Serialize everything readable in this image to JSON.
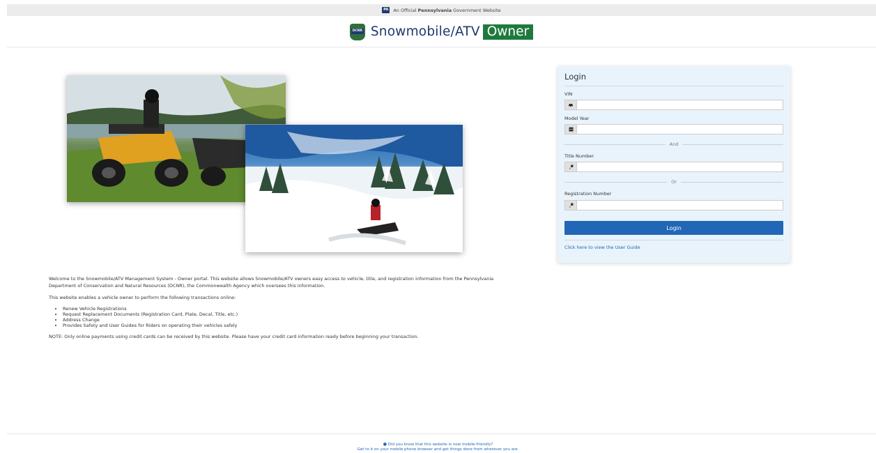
{
  "gov_bar": {
    "badge": "PA",
    "prefix": "An Official",
    "state": "Pennsylvania",
    "suffix": "Government Website"
  },
  "header": {
    "logo_text": "DCNR",
    "brand": "Snowmobile/ATV",
    "tag": "Owner"
  },
  "images": {
    "atv": "atv-photo",
    "snowmobile": "snowmobile-photo"
  },
  "intro": {
    "welcome": "Welcome to the Snowmobile/ATV Management System - Owner portal. This website allows Snowmobile/ATV owners easy access to vehicle, title, and registration information from the Pennsylvania Department of Conservation and Natural Resources (DCNR), the Commonwealth Agency which oversees this information.",
    "enables": "This website enables a vehicle owner to perform the following transactions online:",
    "items": [
      "Renew Vehicle Registrations",
      "Request Replacement Documents (Registration Card, Plate, Decal, Title, etc.)",
      "Address Change",
      "Provides Safety and User Guides for Riders on operating their vehicles safely"
    ],
    "note": "NOTE: Only online payments using credit cards can be received by this website. Please have your credit card information ready before beginning your transaction."
  },
  "login": {
    "title": "Login",
    "vin_label": "VIN",
    "vin_value": "",
    "vin_icon": "car-icon",
    "model_year_label": "Model Year",
    "model_year_value": "",
    "model_year_icon": "calendar-icon",
    "and_text": "And",
    "title_number_label": "Title Number",
    "title_number_value": "",
    "title_number_icon": "key-icon",
    "or_text": "Or",
    "registration_label": "Registration Number",
    "registration_value": "",
    "registration_icon": "key-icon",
    "button": "Login",
    "guide_link": "Click here to view the User Guide"
  },
  "footer": {
    "icon": "map-pin-icon",
    "line1": "Did you know that this website is now mobile-friendly?",
    "line2": "Get to it on your mobile phone browser and get things done from wherever you are."
  },
  "colors": {
    "brand_blue": "#1e3a6e",
    "brand_green": "#1e7a3c",
    "button_blue": "#2266b7",
    "panel_bg": "#e9f3fb"
  }
}
